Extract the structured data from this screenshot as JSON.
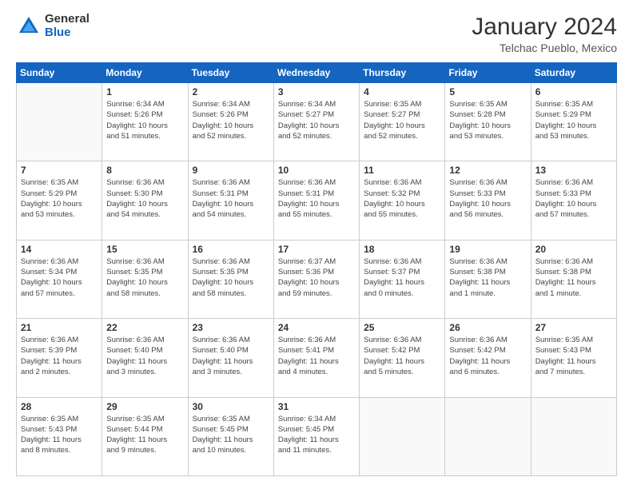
{
  "logo": {
    "general": "General",
    "blue": "Blue"
  },
  "title": "January 2024",
  "subtitle": "Telchac Pueblo, Mexico",
  "headers": [
    "Sunday",
    "Monday",
    "Tuesday",
    "Wednesday",
    "Thursday",
    "Friday",
    "Saturday"
  ],
  "weeks": [
    [
      {
        "day": "",
        "info": ""
      },
      {
        "day": "1",
        "info": "Sunrise: 6:34 AM\nSunset: 5:26 PM\nDaylight: 10 hours\nand 51 minutes."
      },
      {
        "day": "2",
        "info": "Sunrise: 6:34 AM\nSunset: 5:26 PM\nDaylight: 10 hours\nand 52 minutes."
      },
      {
        "day": "3",
        "info": "Sunrise: 6:34 AM\nSunset: 5:27 PM\nDaylight: 10 hours\nand 52 minutes."
      },
      {
        "day": "4",
        "info": "Sunrise: 6:35 AM\nSunset: 5:27 PM\nDaylight: 10 hours\nand 52 minutes."
      },
      {
        "day": "5",
        "info": "Sunrise: 6:35 AM\nSunset: 5:28 PM\nDaylight: 10 hours\nand 53 minutes."
      },
      {
        "day": "6",
        "info": "Sunrise: 6:35 AM\nSunset: 5:29 PM\nDaylight: 10 hours\nand 53 minutes."
      }
    ],
    [
      {
        "day": "7",
        "info": "Sunrise: 6:35 AM\nSunset: 5:29 PM\nDaylight: 10 hours\nand 53 minutes."
      },
      {
        "day": "8",
        "info": "Sunrise: 6:36 AM\nSunset: 5:30 PM\nDaylight: 10 hours\nand 54 minutes."
      },
      {
        "day": "9",
        "info": "Sunrise: 6:36 AM\nSunset: 5:31 PM\nDaylight: 10 hours\nand 54 minutes."
      },
      {
        "day": "10",
        "info": "Sunrise: 6:36 AM\nSunset: 5:31 PM\nDaylight: 10 hours\nand 55 minutes."
      },
      {
        "day": "11",
        "info": "Sunrise: 6:36 AM\nSunset: 5:32 PM\nDaylight: 10 hours\nand 55 minutes."
      },
      {
        "day": "12",
        "info": "Sunrise: 6:36 AM\nSunset: 5:33 PM\nDaylight: 10 hours\nand 56 minutes."
      },
      {
        "day": "13",
        "info": "Sunrise: 6:36 AM\nSunset: 5:33 PM\nDaylight: 10 hours\nand 57 minutes."
      }
    ],
    [
      {
        "day": "14",
        "info": "Sunrise: 6:36 AM\nSunset: 5:34 PM\nDaylight: 10 hours\nand 57 minutes."
      },
      {
        "day": "15",
        "info": "Sunrise: 6:36 AM\nSunset: 5:35 PM\nDaylight: 10 hours\nand 58 minutes."
      },
      {
        "day": "16",
        "info": "Sunrise: 6:36 AM\nSunset: 5:35 PM\nDaylight: 10 hours\nand 58 minutes."
      },
      {
        "day": "17",
        "info": "Sunrise: 6:37 AM\nSunset: 5:36 PM\nDaylight: 10 hours\nand 59 minutes."
      },
      {
        "day": "18",
        "info": "Sunrise: 6:36 AM\nSunset: 5:37 PM\nDaylight: 11 hours\nand 0 minutes."
      },
      {
        "day": "19",
        "info": "Sunrise: 6:36 AM\nSunset: 5:38 PM\nDaylight: 11 hours\nand 1 minute."
      },
      {
        "day": "20",
        "info": "Sunrise: 6:36 AM\nSunset: 5:38 PM\nDaylight: 11 hours\nand 1 minute."
      }
    ],
    [
      {
        "day": "21",
        "info": "Sunrise: 6:36 AM\nSunset: 5:39 PM\nDaylight: 11 hours\nand 2 minutes."
      },
      {
        "day": "22",
        "info": "Sunrise: 6:36 AM\nSunset: 5:40 PM\nDaylight: 11 hours\nand 3 minutes."
      },
      {
        "day": "23",
        "info": "Sunrise: 6:36 AM\nSunset: 5:40 PM\nDaylight: 11 hours\nand 3 minutes."
      },
      {
        "day": "24",
        "info": "Sunrise: 6:36 AM\nSunset: 5:41 PM\nDaylight: 11 hours\nand 4 minutes."
      },
      {
        "day": "25",
        "info": "Sunrise: 6:36 AM\nSunset: 5:42 PM\nDaylight: 11 hours\nand 5 minutes."
      },
      {
        "day": "26",
        "info": "Sunrise: 6:36 AM\nSunset: 5:42 PM\nDaylight: 11 hours\nand 6 minutes."
      },
      {
        "day": "27",
        "info": "Sunrise: 6:35 AM\nSunset: 5:43 PM\nDaylight: 11 hours\nand 7 minutes."
      }
    ],
    [
      {
        "day": "28",
        "info": "Sunrise: 6:35 AM\nSunset: 5:43 PM\nDaylight: 11 hours\nand 8 minutes."
      },
      {
        "day": "29",
        "info": "Sunrise: 6:35 AM\nSunset: 5:44 PM\nDaylight: 11 hours\nand 9 minutes."
      },
      {
        "day": "30",
        "info": "Sunrise: 6:35 AM\nSunset: 5:45 PM\nDaylight: 11 hours\nand 10 minutes."
      },
      {
        "day": "31",
        "info": "Sunrise: 6:34 AM\nSunset: 5:45 PM\nDaylight: 11 hours\nand 11 minutes."
      },
      {
        "day": "",
        "info": ""
      },
      {
        "day": "",
        "info": ""
      },
      {
        "day": "",
        "info": ""
      }
    ]
  ]
}
